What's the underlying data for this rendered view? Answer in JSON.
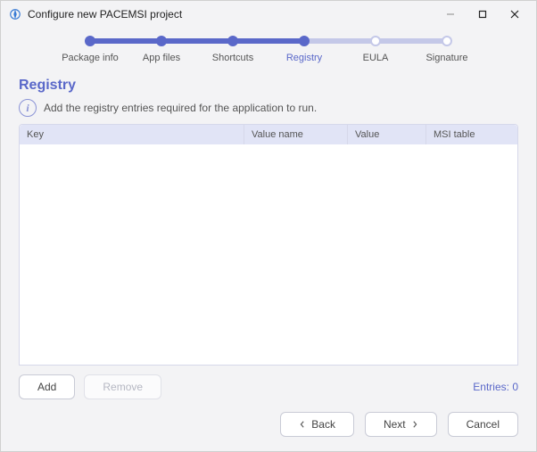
{
  "titlebar": {
    "title": "Configure new PACEMSI project"
  },
  "stepper": {
    "items": [
      {
        "label": "Package info"
      },
      {
        "label": "App files"
      },
      {
        "label": "Shortcuts"
      },
      {
        "label": "Registry"
      },
      {
        "label": "EULA"
      },
      {
        "label": "Signature"
      }
    ]
  },
  "section": {
    "title": "Registry",
    "info": "Add the registry entries required for the application to run."
  },
  "table": {
    "headers": {
      "key": "Key",
      "valueName": "Value name",
      "value": "Value",
      "msiTable": "MSI table"
    }
  },
  "actions": {
    "add": "Add",
    "remove": "Remove",
    "entries_label": "Entries: 0"
  },
  "footer": {
    "back": "Back",
    "next": "Next",
    "cancel": "Cancel"
  }
}
